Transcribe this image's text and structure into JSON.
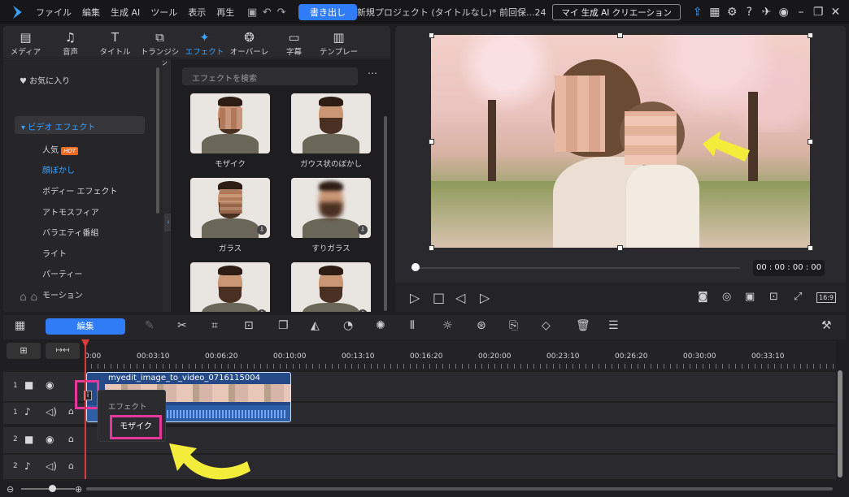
{
  "titlebar": {
    "menus": [
      "ファイル",
      "編集",
      "生成 AI",
      "ツール",
      "表示",
      "再生"
    ],
    "export_label": "書き出し",
    "project_title": "新規プロジェクト (タイトルなし)* 前回保...24",
    "ai_creation_label": "マイ 生成 AI クリエーション"
  },
  "library": {
    "tabs": [
      "メディア",
      "音声",
      "タイトル",
      "トランジション",
      "エフェクト",
      "オーバーレイ",
      "字幕",
      "テンプレート"
    ],
    "active_tab": "エフェクト",
    "sidebar": {
      "favorites": "お気に入り",
      "video_effects": "ビデオ エフェクト",
      "items": [
        "人気",
        "顔ぼかし",
        "ボディー エフェクト",
        "アトモスフィア",
        "バラエティ番組",
        "ライト",
        "パーティー",
        "モーション"
      ],
      "hot_badge": "HOT"
    },
    "search_placeholder": "エフェクトを検索",
    "effects": [
      "モザイク",
      "ガウス状のぼかし",
      "ガラス",
      "すりガラス"
    ]
  },
  "preview": {
    "timecode": "00 : 00 : 00 : 00",
    "aspect": "16:9"
  },
  "timeline": {
    "edit_label": "編集",
    "ticks": [
      "0:00",
      "00:03:10",
      "00:06:20",
      "00:10:00",
      "00:13:10",
      "00:16:20",
      "00:20:00",
      "00:23:10",
      "00:26:20",
      "00:30:00",
      "00:33:10"
    ],
    "tracks": [
      "1",
      "1",
      "2",
      "2"
    ],
    "clip_name": "myedit_image_to_video_0716115004",
    "context_label": "エフェクト",
    "context_item": "モザイク"
  },
  "colors": {
    "accent": "#2f7cf6",
    "highlight": "#e6379b",
    "arrow": "#f4ec3a"
  }
}
